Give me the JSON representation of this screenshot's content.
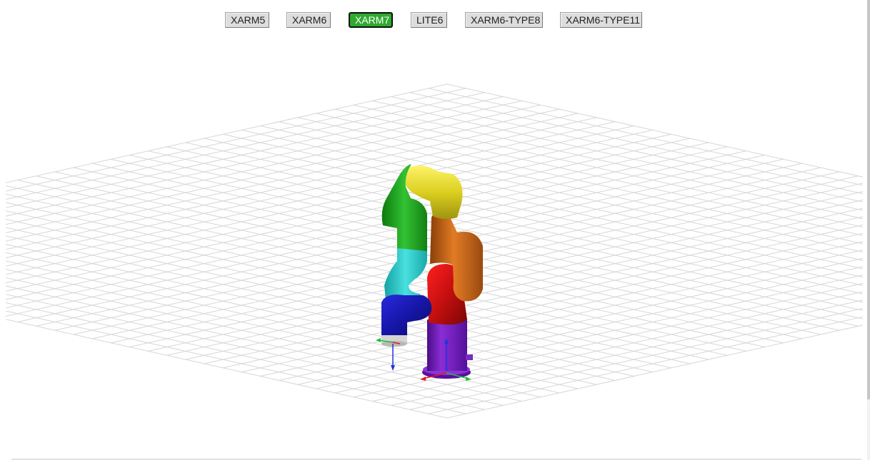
{
  "toolbar": {
    "buttons": [
      {
        "label": "XARM5",
        "active": false
      },
      {
        "label": "XARM6",
        "active": false
      },
      {
        "label": "XARM7",
        "active": true
      },
      {
        "label": "LITE6",
        "active": false
      },
      {
        "label": "XARM6-TYPE8",
        "active": false
      },
      {
        "label": "XARM6-TYPE11",
        "active": false
      }
    ]
  },
  "scene": {
    "selected_model": "XARM7",
    "ground_grid": true,
    "colors": {
      "grid": "#d6d6d6",
      "base": "#6f1bb5",
      "link1": "#c91212",
      "link2": "#c8651a",
      "link3": "#d8cc22",
      "link4": "#24a024",
      "link5": "#2ccac9",
      "link6": "#1c1cb4",
      "end_effector": "#cfcfcf",
      "axis_x": "#e01b1b",
      "axis_y": "#1fbf3a",
      "axis_z": "#2233dd"
    }
  }
}
